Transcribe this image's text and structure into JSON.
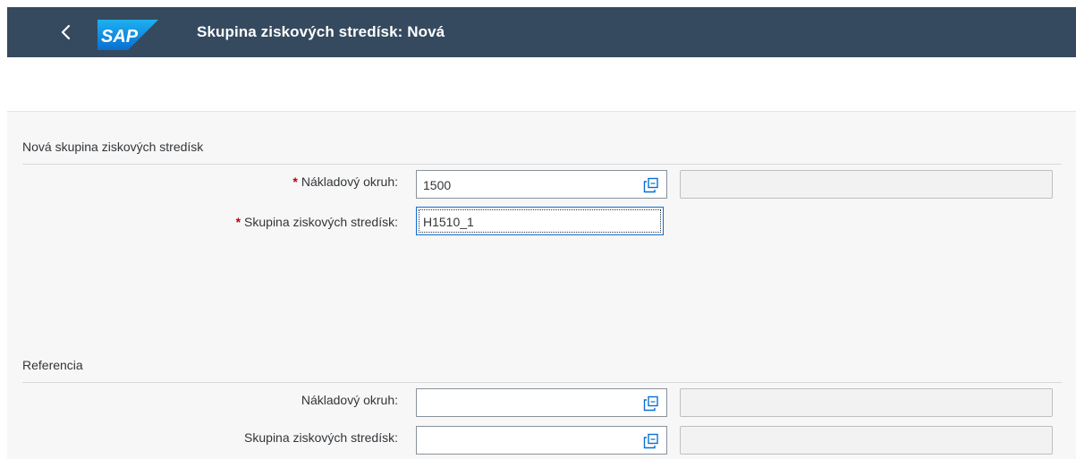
{
  "header": {
    "logo_text": "SAP",
    "title": "Skupina ziskových stredísk: Nová"
  },
  "section_new": {
    "title": "Nová skupina ziskových stredísk",
    "fields": [
      {
        "label": "Nákladový okruh:",
        "required": true,
        "value": "1500",
        "has_value_help": true,
        "description": ""
      },
      {
        "label": "Skupina ziskových stredísk:",
        "required": true,
        "value": "H1510_1",
        "has_value_help": false,
        "focused": true
      }
    ]
  },
  "section_reference": {
    "title": "Referencia",
    "fields": [
      {
        "label": "Nákladový okruh:",
        "required": false,
        "value": "",
        "has_value_help": true,
        "description": ""
      },
      {
        "label": "Skupina ziskových stredísk:",
        "required": false,
        "value": "",
        "has_value_help": true,
        "description": ""
      }
    ]
  },
  "icons": {
    "back": "chevron-left-icon",
    "value_help": "value-help-icon"
  },
  "colors": {
    "shell_bar": "#354a5f",
    "required_marker": "#bb0000",
    "value_help_icon": "#0a6ed1"
  }
}
